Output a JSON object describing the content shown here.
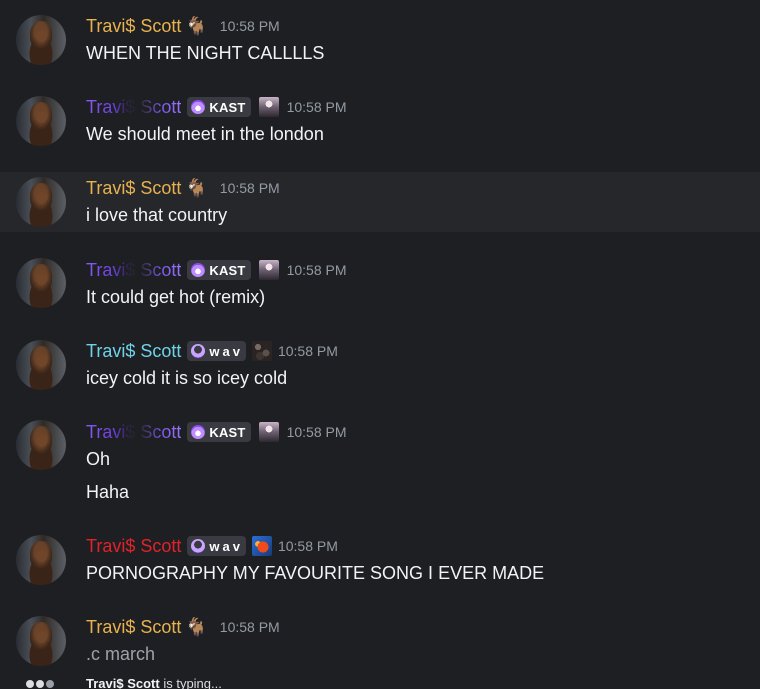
{
  "messages": [
    {
      "author": "Travi$ Scott",
      "style": "gold",
      "decoration": "goat",
      "time": "10:58 PM",
      "lines": [
        "WHEN THE NIGHT CALLLLS"
      ]
    },
    {
      "author": "Travi$ Scott",
      "style": "purple",
      "tag": "KAST",
      "mini": "kast",
      "time": "10:58 PM",
      "lines": [
        "We should meet in the london"
      ]
    },
    {
      "author": "Travi$ Scott",
      "style": "gold",
      "decoration": "goat",
      "time": "10:58 PM",
      "lines": [
        "i love that country"
      ],
      "highlighted": true
    },
    {
      "author": "Travi$ Scott",
      "style": "purple",
      "tag": "KAST",
      "mini": "kast",
      "time": "10:58 PM",
      "lines": [
        "It could get hot (remix)"
      ]
    },
    {
      "author": "Travi$ Scott",
      "style": "cyan",
      "tag": "wav",
      "mini": "noise",
      "time": "10:58 PM",
      "lines": [
        "icey cold it is so icey cold"
      ]
    },
    {
      "author": "Travi$ Scott",
      "style": "purple",
      "tag": "KAST",
      "mini": "kast",
      "time": "10:58 PM",
      "lines": [
        "Oh",
        "Haha"
      ]
    },
    {
      "author": "Travi$ Scott",
      "style": "red",
      "tag": "wav",
      "mini": "fish",
      "time": "10:58 PM",
      "lines": [
        "PORNOGRAPHY MY FAVOURITE SONG I EVER MADE"
      ]
    },
    {
      "author": "Travi$ Scott",
      "style": "gold",
      "decoration": "goat",
      "time": "10:58 PM",
      "lines": [
        ".c march"
      ],
      "pending": true
    }
  ],
  "typing": {
    "user": "Travi$ Scott",
    "suffix": "is typing..."
  },
  "colors": {
    "background": "#1e1f22",
    "highlight": "#26272b",
    "gold": "#e8b24f",
    "purple": "#7a57e8",
    "cyan": "#6fd3e8",
    "red": "#e0232a",
    "timestamp": "#949ba4"
  }
}
